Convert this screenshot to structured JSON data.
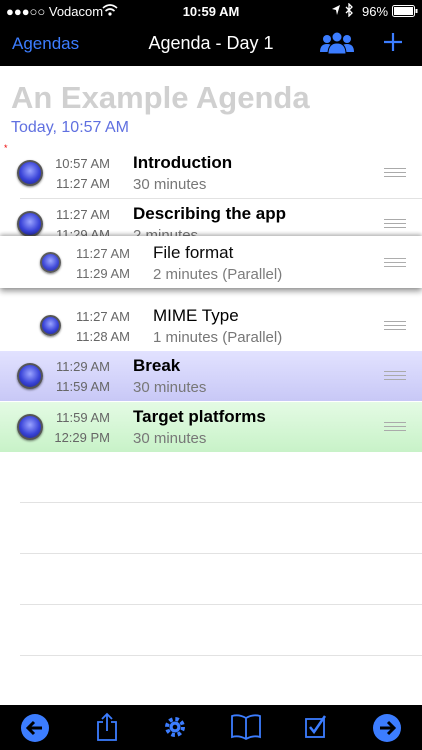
{
  "status_bar": {
    "carrier": "●●●○○ Vodacom",
    "time": "10:59 AM",
    "battery": "96%",
    "icons": [
      "wifi-icon",
      "location-arrow-icon",
      "bluetooth-icon",
      "battery-icon"
    ]
  },
  "nav": {
    "back_label": "Agendas",
    "title": "Agenda - Day 1",
    "right_icons": [
      "people-icon",
      "plus-icon"
    ]
  },
  "agenda": {
    "title": "An Example Agenda",
    "date": "Today, 10:57 AM"
  },
  "items": [
    {
      "start": "10:57 AM",
      "end": "11:27 AM",
      "title": "Introduction",
      "duration": "30 minutes"
    },
    {
      "start": "11:27 AM",
      "end": "11:29 AM",
      "title": "Describing the app",
      "duration": "2 minutes"
    },
    {
      "start": "11:27 AM",
      "end": "11:29 AM",
      "title": "File format",
      "duration": "2 minutes (Parallel)"
    },
    {
      "start": "11:27 AM",
      "end": "11:28 AM",
      "title": "MIME Type",
      "duration": "1 minutes (Parallel)"
    },
    {
      "start": "11:29 AM",
      "end": "11:59 AM",
      "title": "Break",
      "duration": "30 minutes"
    },
    {
      "start": "11:59 AM",
      "end": "12:29 PM",
      "title": "Target platforms",
      "duration": "30 minutes"
    }
  ],
  "colors": {
    "accent": "#3c7dff",
    "break_row": "#d6d6ff",
    "target_row": "#d4f7d4"
  },
  "tab_bar": {
    "icons": [
      "back-arrow-icon",
      "share-icon",
      "gear-icon",
      "book-icon",
      "checklist-icon",
      "forward-arrow-icon"
    ]
  }
}
